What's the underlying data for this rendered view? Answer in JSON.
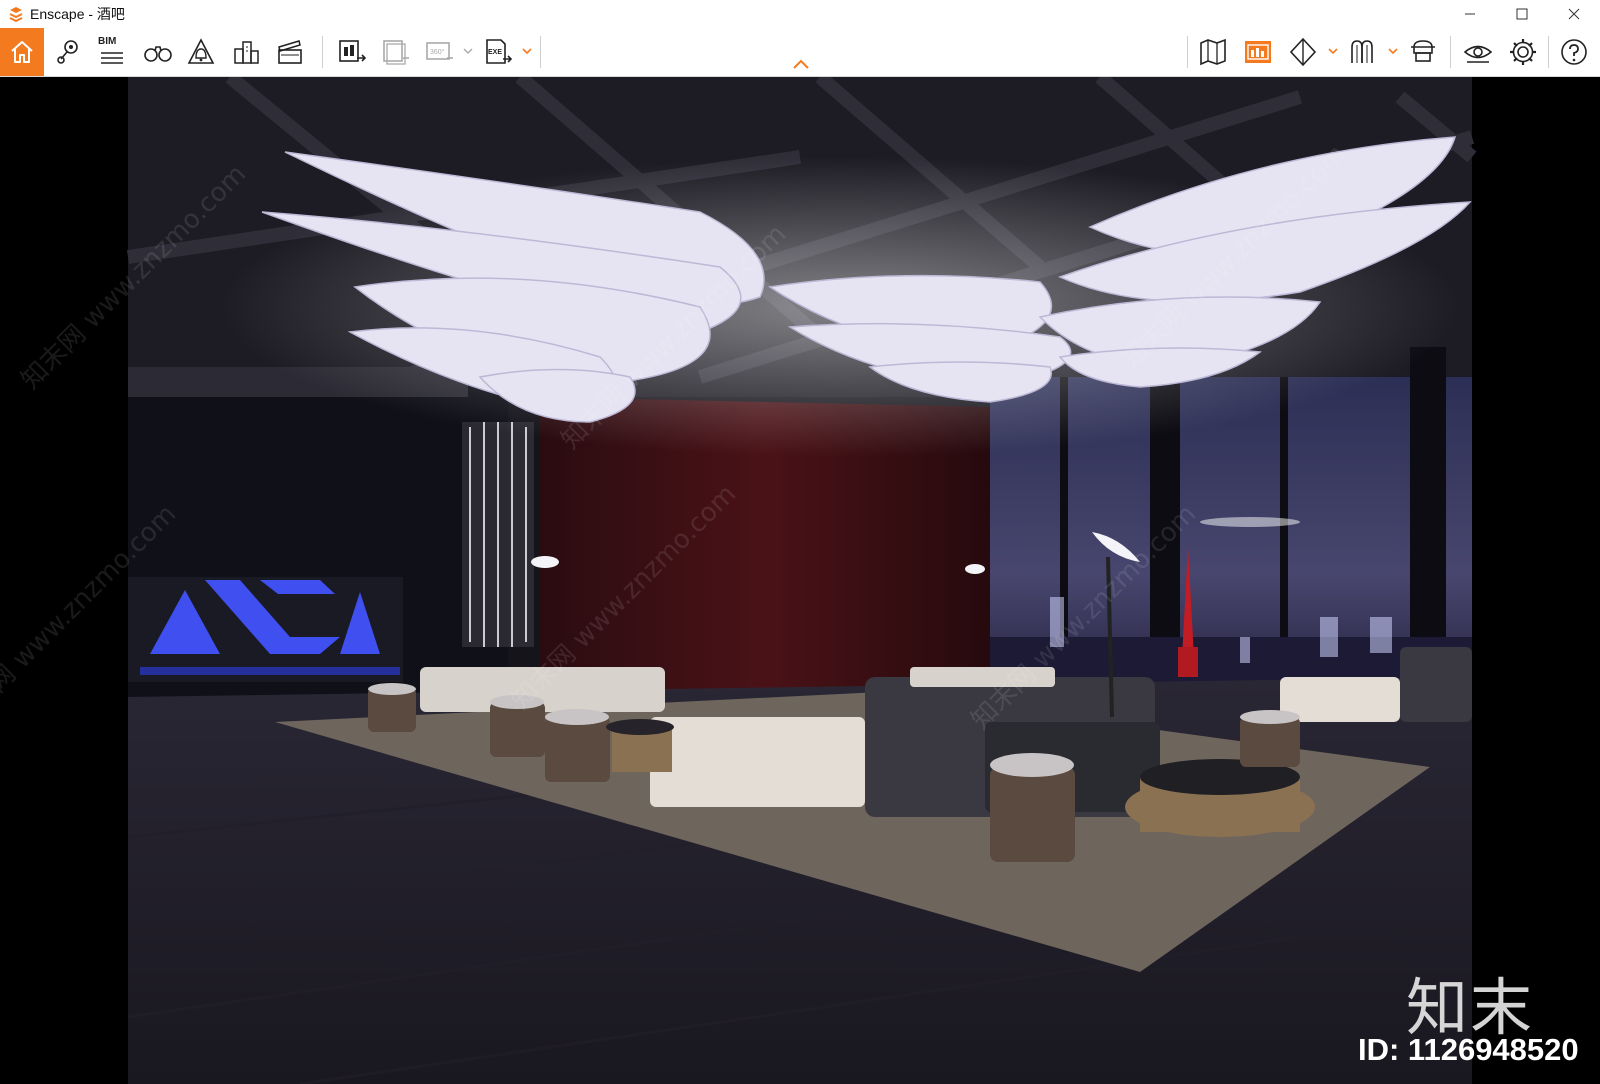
{
  "window": {
    "app_name": "Enscape",
    "title": "Enscape - 酒吧"
  },
  "toolbar": {
    "bim_label": "BIM",
    "video_360_label": "360°",
    "exe_label": "EXE",
    "accent_color": "#f47a20",
    "left_tools": [
      "home-icon",
      "location-pin-icon",
      "bim-list-icon",
      "binoculars-icon",
      "bell-icon",
      "buildings-icon",
      "clapperboard-icon",
      "screenshot-export-icon",
      "batch-render-icon",
      "panorama-360-icon",
      "exe-export-icon"
    ],
    "right_tools": [
      "map-icon",
      "asset-library-icon",
      "cube-icon",
      "materials-icon",
      "upload-icon",
      "eye-icon",
      "gear-icon",
      "help-icon"
    ]
  },
  "viewport": {
    "watermark_logo": "知末",
    "watermark_id": "ID: 1126948520",
    "watermark_diagonal": "知末网 www.znzmo.com"
  }
}
